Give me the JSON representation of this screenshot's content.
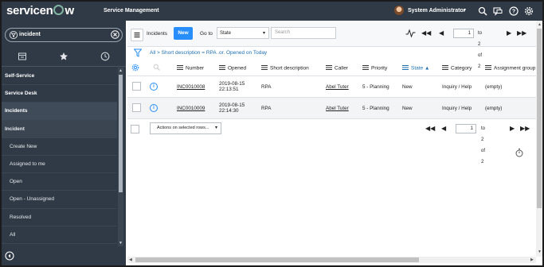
{
  "header": {
    "brand": "servicenow",
    "app_title": "Service Management",
    "user_name": "System Administrator",
    "icons": [
      "search-icon",
      "chat-icon",
      "help-icon",
      "gear-icon"
    ]
  },
  "navigator": {
    "filter_value": "incident",
    "tabs": [
      "all-apps-icon",
      "favorites-icon",
      "history-icon"
    ],
    "items": [
      {
        "label": "Self-Service",
        "kind": "section"
      },
      {
        "label": "Service Desk",
        "kind": "section"
      },
      {
        "label": "Incidents",
        "kind": "active"
      },
      {
        "label": "Incident",
        "kind": "hilite"
      },
      {
        "label": "Create New",
        "kind": "module"
      },
      {
        "label": "Assigned to me",
        "kind": "module"
      },
      {
        "label": "Open",
        "kind": "module"
      },
      {
        "label": "Open - Unassigned",
        "kind": "module"
      },
      {
        "label": "Resolved",
        "kind": "module"
      },
      {
        "label": "All",
        "kind": "module"
      }
    ]
  },
  "list": {
    "title": "Incidents",
    "new_label": "New",
    "goto_label": "Go to",
    "goto_field": "State",
    "search_placeholder": "Search",
    "page_value": "1",
    "page_text": "to 2 of 2",
    "breadcrumb": "All > Short description = RPA .or. Opened on Today",
    "columns": [
      "Number",
      "Opened",
      "Short description",
      "Caller",
      "Priority",
      "State",
      "Category",
      "Assignment group"
    ],
    "sorted_column": "State",
    "rows": [
      {
        "number": "INC0010008",
        "opened_date": "2019-08-15",
        "opened_time": "22:13:51",
        "short_description": "RPA",
        "caller": "Abel Tuter",
        "priority": "5 - Planning",
        "state": "New",
        "category": "Inquiry / Help",
        "assignment_group": "(empty)"
      },
      {
        "number": "INC0010009",
        "opened_date": "2019-08-15",
        "opened_time": "22:14:30",
        "short_description": "RPA",
        "caller": "Abel Tuter",
        "priority": "5 - Planning",
        "state": "New",
        "category": "Inquiry / Help",
        "assignment_group": "(empty)"
      }
    ],
    "actions_label": "Actions on selected rows...",
    "colors": {
      "accent": "#278efc",
      "header": "#303a46",
      "link": "#1f6fb2"
    }
  }
}
